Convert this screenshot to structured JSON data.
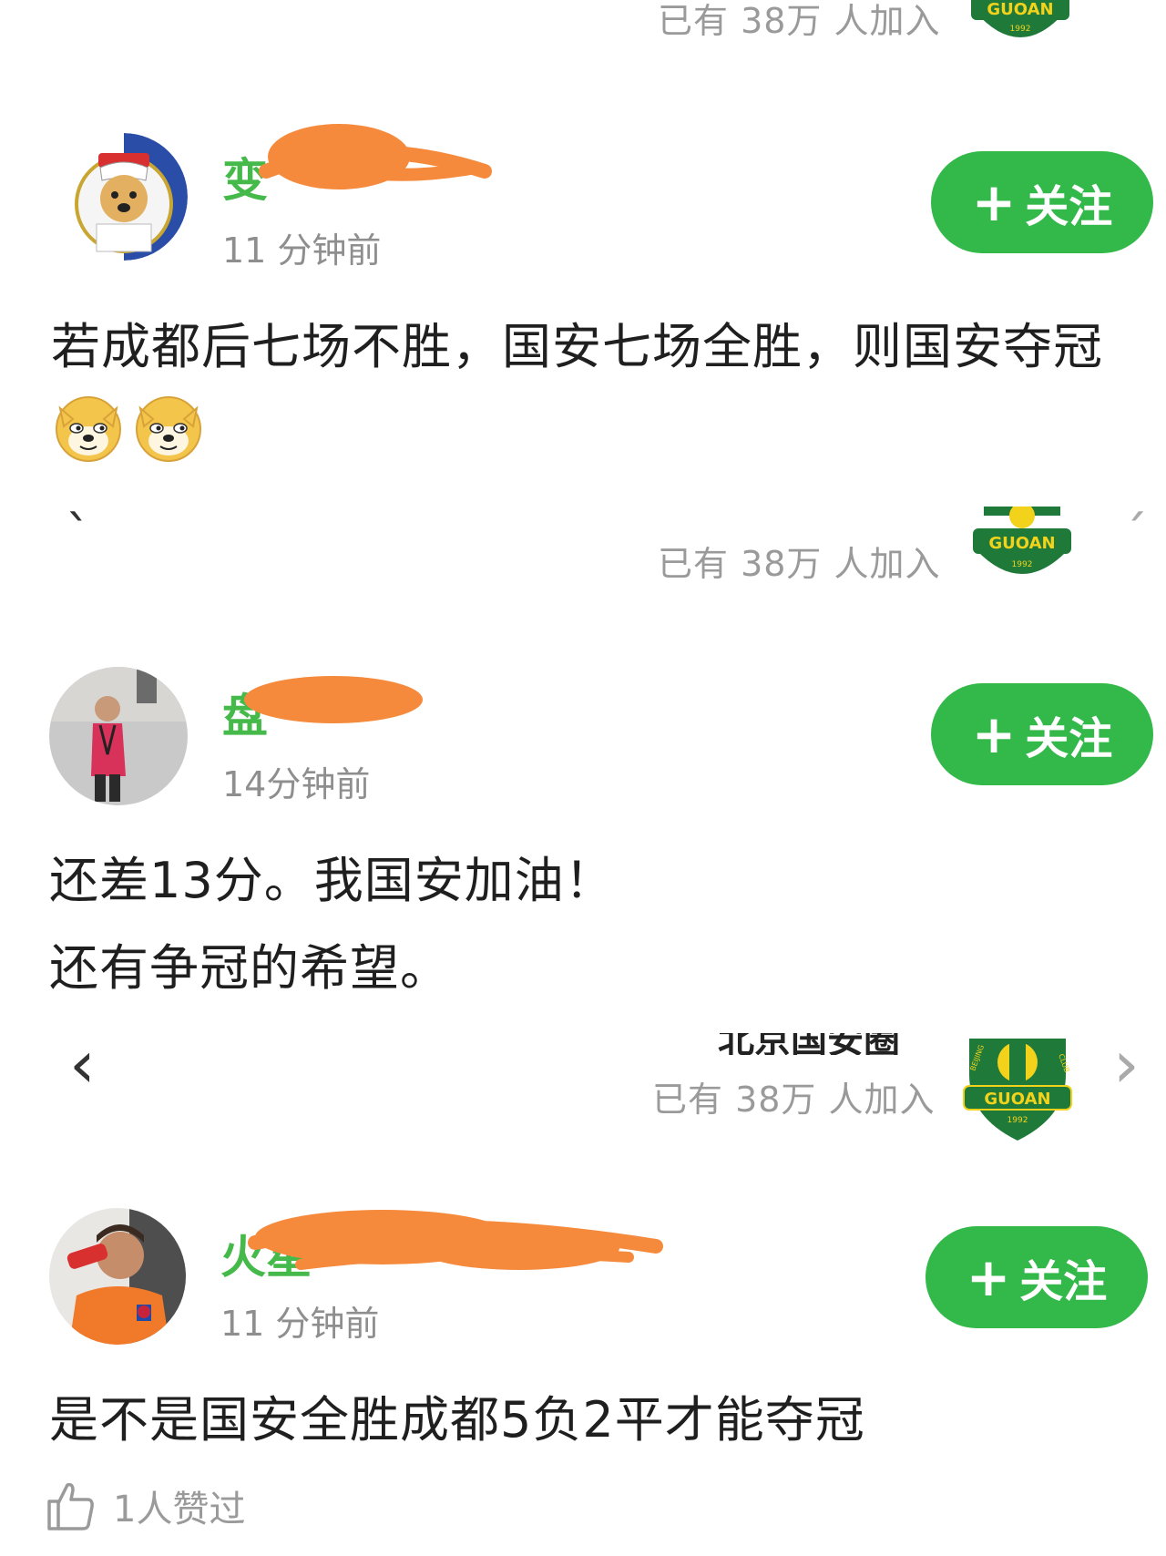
{
  "community": {
    "join_text": "已有 38万 人加入",
    "cut_title": "北京国安圈",
    "badge_text": "GUOAN",
    "badge_year": "1992",
    "badge_club_text": "CLUB",
    "badge_city_text": "BEIJING",
    "colors": {
      "green": "#1f7a3a",
      "yellow": "#f2d21b"
    }
  },
  "posts": [
    {
      "username": "变",
      "time": "11 分钟前",
      "follow_label": "关注",
      "lines": [
        "若成都后七场不胜，国安七场全胜，则国安夺冠"
      ],
      "emoji_count": 2,
      "emoji_name": "doge-emoji"
    },
    {
      "username": "盘",
      "time": "14分钟前",
      "follow_label": "关注",
      "lines": [
        "还差13分。我国安加油！",
        "还有争冠的希望。"
      ]
    },
    {
      "username": "火星",
      "time": "11 分钟前",
      "follow_label": "关注",
      "lines": [
        "是不是国安全胜成都5负2平才能夺冠"
      ]
    }
  ],
  "likes": {
    "text": "1人赞过",
    "icon": "thumbs-up-icon"
  },
  "nav": {
    "prev": "‹",
    "next": "›",
    "prev_small": "ˋ",
    "next_small": "ˊ"
  },
  "accent": "#33b84a",
  "username_color": "#45b94a",
  "scribble_color": "#f58a3c"
}
